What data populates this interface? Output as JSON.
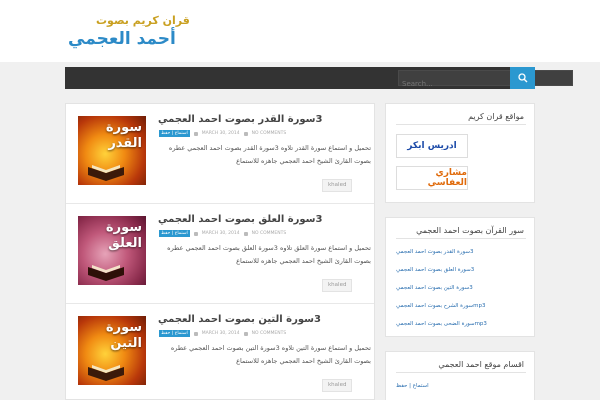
{
  "header": {
    "logo_top": "قران كريم بصوت",
    "logo_main": "أحمد العجمي"
  },
  "nav": {
    "search_placeholder": "Search..."
  },
  "posts": [
    {
      "title": "3سورة القدر بصوت احمد العجمي",
      "thumb_title": "سورة القدر",
      "category": "استماع | حفظ",
      "date": "MARCH 30, 2014",
      "comments": "NO COMMENTS",
      "excerpt": "تحميل و استماع سورة القدر تلاوه 3سورة القدر بصوت احمد العجمي عطره بصوت القارئ الشيخ احمد العجمي جاهزه للاستماع",
      "author": "khaled"
    },
    {
      "title": "3سورة العلق بصوت احمد العجمي",
      "thumb_title": "سورة العلق",
      "category": "استماع | حفظ",
      "date": "MARCH 30, 2014",
      "comments": "NO COMMENTS",
      "excerpt": "تحميل و استماع سورة العلق تلاوه 3سورة العلق بصوت احمد العجمي عطره بصوت القارئ الشيخ احمد العجمي جاهزه للاستماع",
      "author": "khaled"
    },
    {
      "title": "3سورة التين بصوت احمد العجمي",
      "thumb_title": "سورة التين",
      "category": "استماع | حفظ",
      "date": "MARCH 30, 2014",
      "comments": "NO COMMENTS",
      "excerpt": "تحميل و استماع سورة التين تلاوه 3سورة التين بصوت احمد العجمي عطره بصوت القارئ الشيخ احمد العجمي جاهزه للاستماع",
      "author": "khaled"
    }
  ],
  "sidebar": {
    "widget1": {
      "title": "مواقع قران كريم",
      "banner1": "ادريس ابكر",
      "banner2": "مشاري العفاسي"
    },
    "widget2": {
      "title": "سور القرآن بصوت احمد العجمي",
      "links": [
        "3سورة القدر بصوت احمد العجمي",
        "3سورة العلق بصوت احمد العجمي",
        "3سورة التين بصوت احمد العجمي",
        "mp3سورة الشرح بصوت احمد العجمي",
        "mp3سورة الضحى بصوت احمد العجمي"
      ]
    },
    "widget3": {
      "title": "اقسام موقع احمد العجمي",
      "link": "استماع | حفظ"
    }
  },
  "colors": {
    "accent": "#2b98d0",
    "nav_bg": "#333333",
    "page_bg": "#f0f0f0",
    "logo_gold": "#c9a021",
    "logo_blue": "#2c8ac7"
  }
}
